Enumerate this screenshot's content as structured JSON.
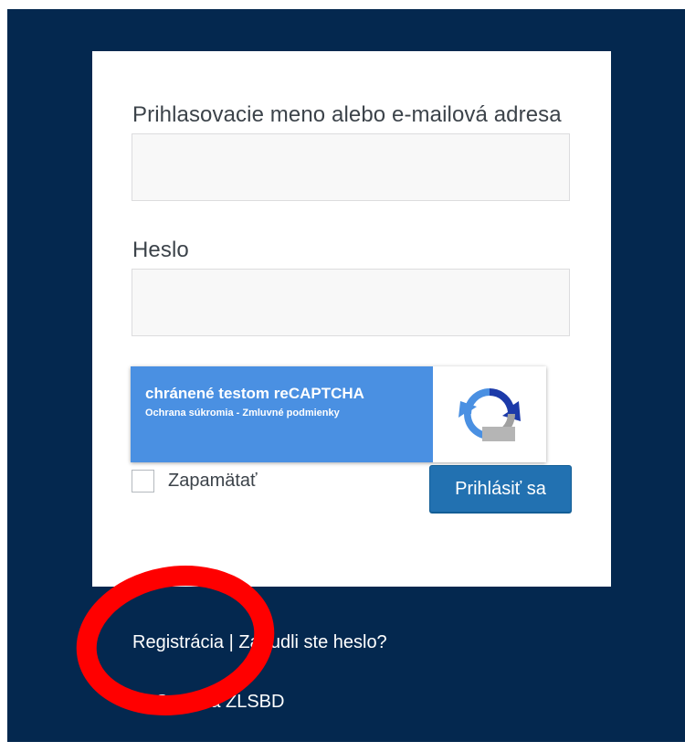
{
  "form": {
    "username_label": "Prihlasovacie meno alebo e-mailová adresa",
    "username_value": "",
    "password_label": "Heslo",
    "password_value": "",
    "recaptcha": {
      "title": "chránené testom reCAPTCHA",
      "subtitle": "Ochrana súkromia - Zmluvné podmienky",
      "icon": "recaptcha-logo-icon"
    },
    "remember_label": "Zapamätať",
    "remember_checked": false,
    "submit_label": "Prihlásiť sa"
  },
  "footer": {
    "register_link": "Registrácia",
    "separator": " | ",
    "lost_password_link": "Zabudli ste heslo?",
    "back_link": "← Späť na ZLSBD"
  },
  "annotation": {
    "color": "#ff0000",
    "shape": "red-ellipse"
  },
  "colors": {
    "background": "#04284f",
    "card": "#ffffff",
    "button": "#2271b1",
    "recaptcha_blue": "#4a90e2"
  }
}
